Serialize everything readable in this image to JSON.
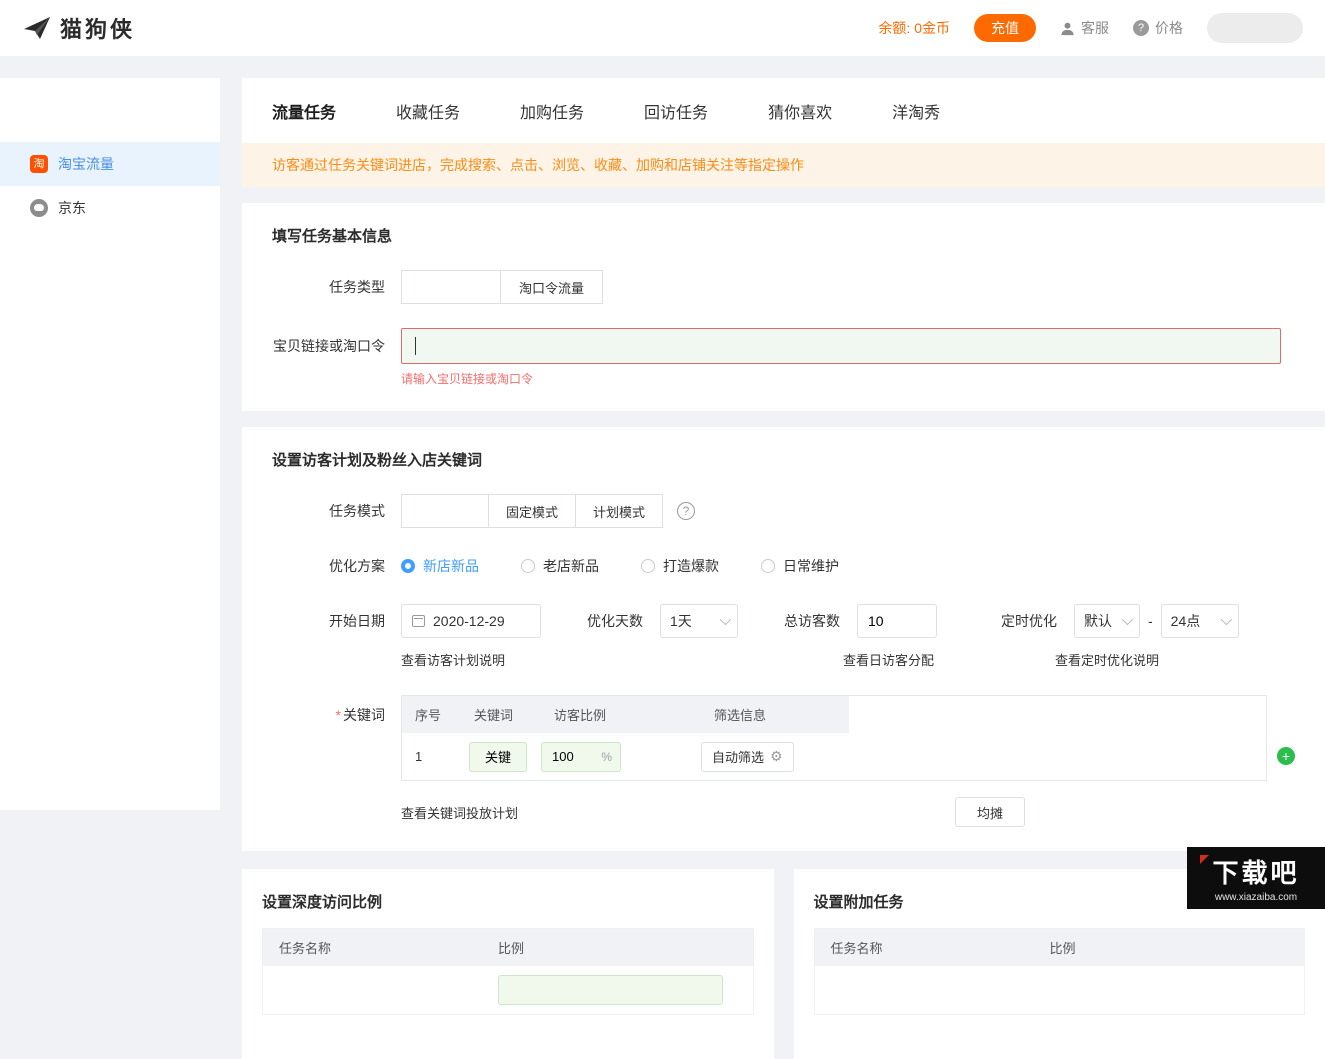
{
  "colors": {
    "accent_orange": "#ff6a00",
    "notice_orange": "#fa8c16",
    "primary_blue": "#409eff",
    "sidebar_active_blue": "#4a90e2",
    "error_red": "#f56c6c",
    "add_green": "#2dbd4e",
    "input_green_bg": "#f0f9eb"
  },
  "icons": {
    "taobao": "淘",
    "help": "?",
    "question": "?",
    "gear": "⚙",
    "plus": "+"
  },
  "header": {
    "logo_text": "猫狗侠",
    "balance_label": "余额: 0金币",
    "recharge_label": "充值",
    "service_label": "客服",
    "price_label": "价格"
  },
  "sidebar": {
    "items": [
      {
        "label": "淘宝流量",
        "active": true
      },
      {
        "label": "京东",
        "active": false
      }
    ]
  },
  "tabs": [
    {
      "label": "流量任务",
      "active": true
    },
    {
      "label": "收藏任务",
      "active": false
    },
    {
      "label": "加购任务",
      "active": false
    },
    {
      "label": "回访任务",
      "active": false
    },
    {
      "label": "猜你喜欢",
      "active": false
    },
    {
      "label": "洋淘秀",
      "active": false
    }
  ],
  "notice": "访客通过任务关键词进店，完成搜索、点击、浏览、收藏、加购和店铺关注等指定操作",
  "basic_info": {
    "title": "填写任务基本信息",
    "task_type_label": "任务类型",
    "task_type_options": [
      "",
      "淘口令流量"
    ],
    "link_label": "宝贝链接或淘口令",
    "link_value": "",
    "link_error": "请输入宝贝链接或淘口令"
  },
  "visitor_plan": {
    "title": "设置访客计划及粉丝入店关键词",
    "task_mode_label": "任务模式",
    "task_mode_options": [
      "",
      "固定模式",
      "计划模式"
    ],
    "optimize_label": "优化方案",
    "optimize_options": [
      {
        "label": "新店新品",
        "selected": true
      },
      {
        "label": "老店新品",
        "selected": false
      },
      {
        "label": "打造爆款",
        "selected": false
      },
      {
        "label": "日常维护",
        "selected": false
      }
    ],
    "start_date_label": "开始日期",
    "start_date_value": "2020-12-29",
    "optimize_days_label": "优化天数",
    "optimize_days_value": "1天",
    "total_visitors_label": "总访客数",
    "total_visitors_value": "10",
    "timed_optimize_label": "定时优化",
    "timed_start_value": "默认",
    "timed_separator": "-",
    "timed_end_value": "24点",
    "links": {
      "visitor_plan": "查看访客计划说明",
      "daily_allocation": "查看日访客分配",
      "timed_optimize": "查看定时优化说明",
      "keyword_plan": "查看关键词投放计划"
    },
    "keyword_label": "关键词",
    "required_mark": "*",
    "keyword_table": {
      "headers": [
        "序号",
        "关键词",
        "访客比例",
        "筛选信息"
      ],
      "row": {
        "index": "1",
        "keyword": "关键",
        "ratio": "100",
        "ratio_unit": "%",
        "filter_button": "自动筛选"
      }
    },
    "share_button": "均摊"
  },
  "depth_visit": {
    "title": "设置深度访问比例",
    "headers": [
      "任务名称",
      "比例"
    ]
  },
  "extra_task": {
    "title": "设置附加任务",
    "headers": [
      "任务名称",
      "比例"
    ]
  },
  "watermark": {
    "title": "下载吧",
    "url": "www.xiazaiba.com"
  }
}
